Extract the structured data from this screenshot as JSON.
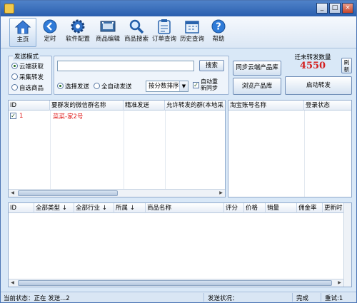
{
  "window": {
    "title": "",
    "minimize": "_",
    "maximize": "□",
    "close": "×"
  },
  "toolbar": {
    "items": [
      {
        "label": "主页",
        "icon": "home-icon"
      },
      {
        "label": "定时",
        "icon": "clock-back-icon"
      },
      {
        "label": "软件配置",
        "icon": "gear-icon"
      },
      {
        "label": "商品编辑",
        "icon": "film-edit-icon"
      },
      {
        "label": "商品搜索",
        "icon": "magnifier-icon"
      },
      {
        "label": "订单查询",
        "icon": "clipboard-icon"
      },
      {
        "label": "历史查询",
        "icon": "calendar-icon"
      },
      {
        "label": "帮助",
        "icon": "help-icon"
      }
    ]
  },
  "send_mode": {
    "title": "发送模式",
    "options": [
      "云端获取",
      "采集转发",
      "自选商品"
    ],
    "selected": "云端获取"
  },
  "search": {
    "value": "",
    "button": "搜索"
  },
  "send_options": {
    "select_send": "选择发送",
    "auto_send": "全自动发送",
    "sort": "按分数排序",
    "auto_sync_line1": "自动重",
    "auto_sync_line2": "新同步"
  },
  "buttons": {
    "sync_cloud": "同步云端产品库",
    "browse": "浏览产品库",
    "start_forward": "启动转发",
    "refresh": "刷新"
  },
  "pending": {
    "label": "迁未转发数量",
    "count": "4550"
  },
  "group_table": {
    "columns": [
      "ID",
      "要群发的微信群名称",
      "精准发送",
      "允许转发的群(本地采"
    ],
    "rows": [
      {
        "id": "1",
        "name": "菜菜-家2号",
        "checked": true
      }
    ]
  },
  "taobao_table": {
    "columns": [
      "淘宝账号名称",
      "登录状态"
    ]
  },
  "product_table": {
    "columns": [
      "ID",
      "全部类型 ↓",
      "全部行业 ↓",
      "所属 ↓",
      "商品名称",
      "评分",
      "价格",
      "销量",
      "佣金率",
      "更新时"
    ]
  },
  "status": {
    "current": "当前状态：正在 发送...2",
    "send_status": "发送状况：",
    "done": "完成",
    "retry": "重试:1"
  },
  "colors": {
    "accent": "#2b5fae",
    "count": "#d42020",
    "row_text": "#e02020"
  }
}
